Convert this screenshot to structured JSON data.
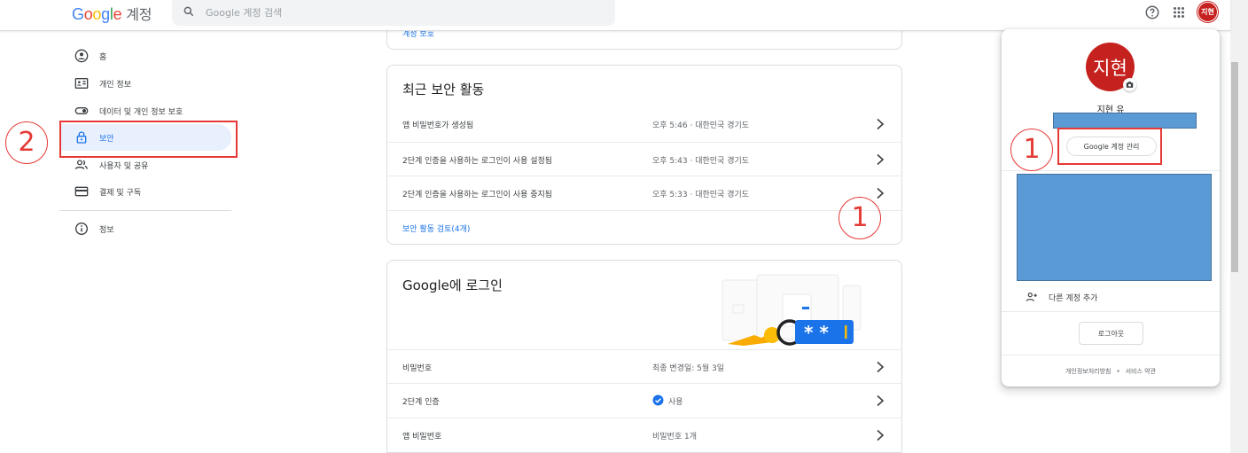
{
  "header": {
    "logo_letters": [
      "G",
      "o",
      "o",
      "g",
      "l",
      "e"
    ],
    "logo_suffix": "계정",
    "search_placeholder": "Google 계정 검색",
    "avatar_initials": "지현"
  },
  "sidebar": {
    "items": [
      {
        "label": "홈",
        "icon": "home-icon"
      },
      {
        "label": "개인 정보",
        "icon": "id-card-icon"
      },
      {
        "label": "데이터 및 개인 정보 보호",
        "icon": "toggle-icon"
      },
      {
        "label": "보안",
        "icon": "lock-icon",
        "active": true
      },
      {
        "label": "사용자 및 공유",
        "icon": "people-icon"
      },
      {
        "label": "결제 및 구독",
        "icon": "card-icon"
      },
      {
        "label": "정보",
        "icon": "info-icon"
      }
    ]
  },
  "top_card": {
    "link": "계정 보호"
  },
  "recent_activity": {
    "title": "최근 보안 활동",
    "rows": [
      {
        "name": "앱 비밀번호가 생성됨",
        "detail": "오후 5:46 · 대한민국 경기도"
      },
      {
        "name": "2단계 인증을 사용하는 로그인이 사용 설정됨",
        "detail": "오후 5:43 · 대한민국 경기도"
      },
      {
        "name": "2단계 인증을 사용하는 로그인이 사용 중지됨",
        "detail": "오후 5:33 · 대한민국 경기도"
      }
    ],
    "review_link": "보안 활동 검토(4개)"
  },
  "signin": {
    "title": "Google에 로그인",
    "rows": [
      {
        "name": "비밀번호",
        "detail": "최종 변경일: 5월 3일"
      },
      {
        "name": "2단계 인증",
        "detail": "사용",
        "check": true
      },
      {
        "name": "앱 비밀번호",
        "detail": "비밀번호 1개"
      }
    ]
  },
  "popup": {
    "avatar_text": "지현",
    "name": "지현 유",
    "manage_button": "Google 계정 관리",
    "add_account": "다른 계정 추가",
    "logout": "로그아웃",
    "privacy": "개인정보처리방침",
    "separator": "•",
    "terms": "서비스 약관"
  },
  "annotations": {
    "num_1": "1",
    "num_2": "2",
    "color": "#e53935"
  },
  "colors": {
    "accent": "#1a73e8",
    "avatar": "#c5221f",
    "active_nav_bg": "#e8f0fe",
    "redaction": "#5b9bd5"
  }
}
